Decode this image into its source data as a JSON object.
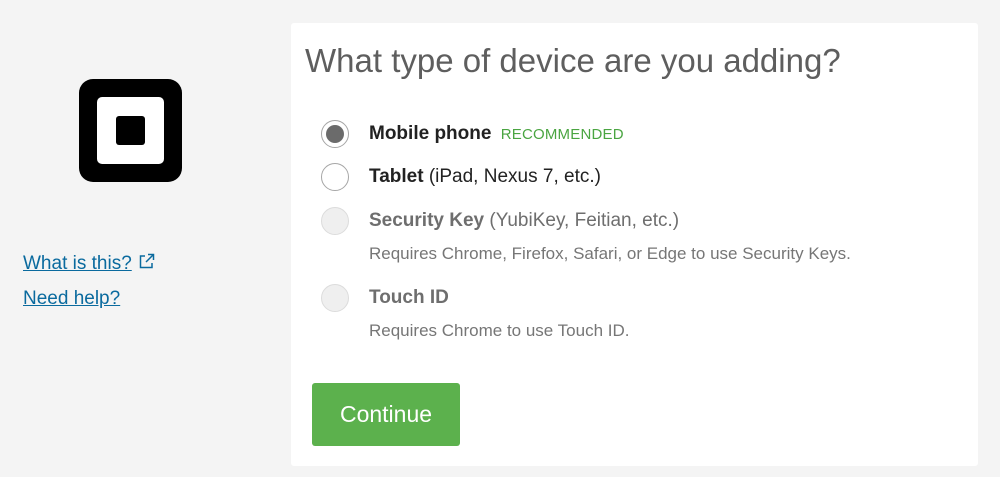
{
  "brand": {
    "logo_icon": "square-logo-icon"
  },
  "side_links": {
    "what_is_this": "What is this?",
    "need_help": "Need help?"
  },
  "card": {
    "title": "What type of device are you adding?",
    "options": [
      {
        "name": "Mobile phone",
        "details": "",
        "badge": "RECOMMENDED",
        "selected": true,
        "disabled": false
      },
      {
        "name": "Tablet",
        "details": "(iPad, Nexus 7, etc.)",
        "selected": false,
        "disabled": false
      },
      {
        "name": "Security Key",
        "details": "(YubiKey, Feitian, etc.)",
        "help": "Requires Chrome, Firefox, Safari, or Edge to use Security Keys.",
        "selected": false,
        "disabled": true
      },
      {
        "name": "Touch ID",
        "details": "",
        "help": "Requires Chrome to use Touch ID.",
        "selected": false,
        "disabled": true
      }
    ],
    "continue_label": "Continue"
  },
  "colors": {
    "page_bg": "#f4f4f4",
    "link": "#0a6a9e",
    "recommended": "#4aa541",
    "button_bg": "#5cb14d",
    "title": "#5e5e5e"
  }
}
